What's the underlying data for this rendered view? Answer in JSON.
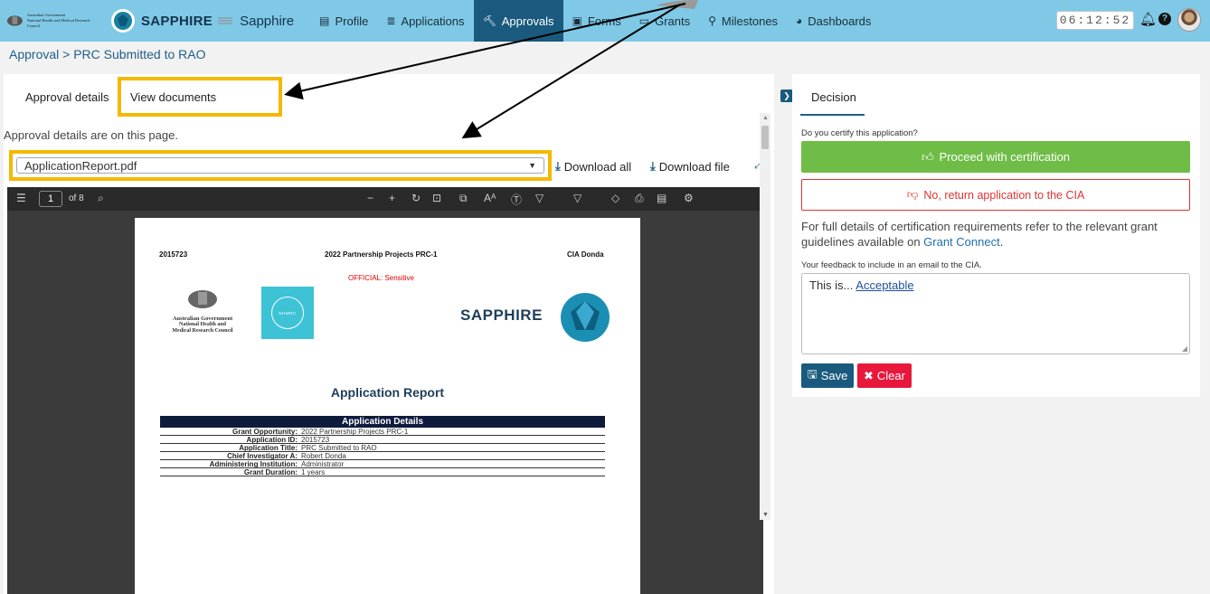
{
  "navbar": {
    "gov_line1": "Australian Government",
    "gov_line2": "National Health and Medical Research Council",
    "brand": "SAPPHIRE",
    "app_name": "Sapphire",
    "items": [
      {
        "label": "Profile",
        "icon": "id-card-icon"
      },
      {
        "label": "Applications",
        "icon": "list-icon"
      },
      {
        "label": "Approvals",
        "icon": "gavel-icon",
        "active": true
      },
      {
        "label": "Forms",
        "icon": "form-icon"
      },
      {
        "label": "Grants",
        "icon": "monitor-icon"
      },
      {
        "label": "Milestones",
        "icon": "map-pin-icon"
      },
      {
        "label": "Dashboards",
        "icon": "dashboard-icon"
      }
    ],
    "timer": "06:12:52"
  },
  "breadcrumb": "Approval > PRC Submitted to RAO",
  "left": {
    "tabs": [
      "Approval details",
      "View documents"
    ],
    "hint": "Approval details are on this page.",
    "select_value": "ApplicationReport.pdf",
    "download_all": "Download all",
    "download_file": "Download file"
  },
  "pdf": {
    "page_number": "1",
    "page_total": "of 8",
    "header_left": "2015723",
    "header_mid": "2022 Partnership Projects PRC-1",
    "header_right": "CIA Donda",
    "official": "OFFICIAL: Sensitive",
    "gov_title": "Australian Government",
    "gov_sub1": "National Health and",
    "gov_sub2": "Medical Research Council",
    "nhmrc": "NHMRC",
    "sapphire": "SAPPHIRE",
    "report_title": "Application Report",
    "table_title": "Application Details",
    "rows": [
      {
        "k": "Grant Opportunity:",
        "v": "2022 Partnership Projects PRC-1"
      },
      {
        "k": "Application ID:",
        "v": "2015723"
      },
      {
        "k": "Application Title:",
        "v": "PRC Submitted to RAO"
      },
      {
        "k": "Chief Investigator A:",
        "v": "Robert Donda"
      },
      {
        "k": "Administering Institution:",
        "v": "Administrator"
      },
      {
        "k": "Grant Duration:",
        "v": "1 years"
      }
    ]
  },
  "right": {
    "tab": "Decision",
    "question": "Do you certify this application?",
    "proceed": "Proceed with certification",
    "return": "No, return application to the CIA",
    "info_text": "For full details of certification requirements refer to the relevant grant guidelines available on ",
    "info_link": "Grant Connect",
    "info_end": ".",
    "feedback_label": "Your feedback to include in an email to the CIA.",
    "feedback_prefix": "This is... ",
    "feedback_autocorrect": "Acceptable",
    "save": "Save",
    "clear": "Clear"
  },
  "colors": {
    "nav_bg": "#7fc9e6",
    "nav_active": "#1a5a7e",
    "highlight": "#f5b800",
    "proceed": "#6fbd46",
    "return": "#dd3333",
    "clear": "#e8183c"
  }
}
